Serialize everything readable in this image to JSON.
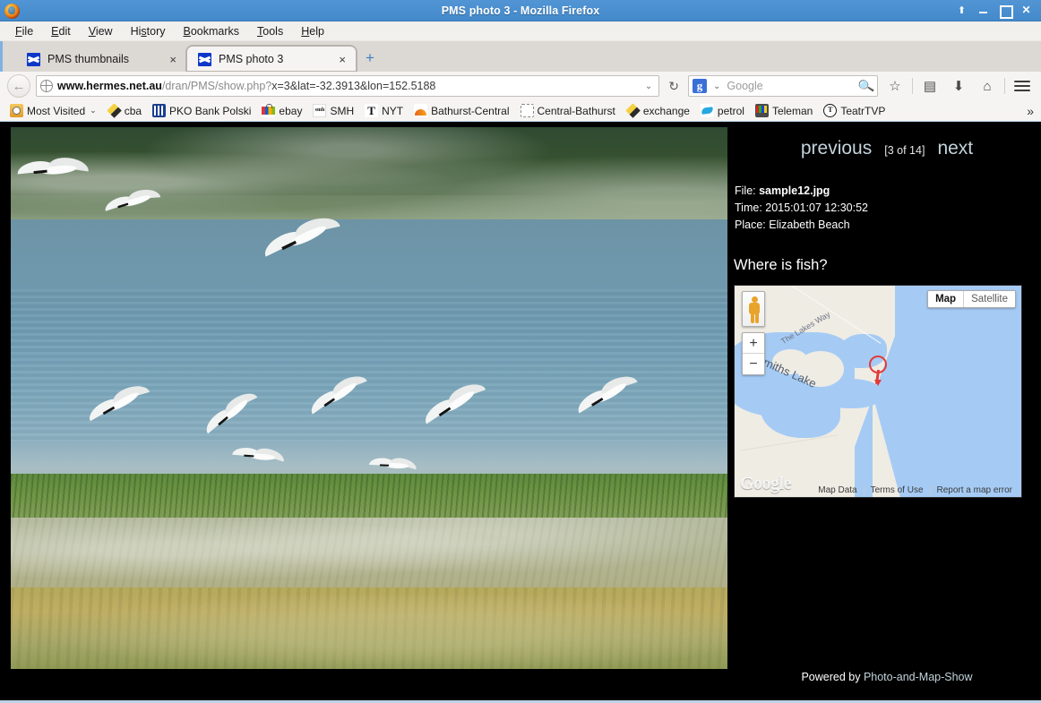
{
  "window": {
    "title": "PMS photo 3 - Mozilla Firefox",
    "controls": {
      "shade": "shade-button",
      "minimize": "minimize-button",
      "maximize": "maximize-button",
      "close": "close-button"
    }
  },
  "menubar": {
    "items": [
      {
        "label": "File",
        "accel": "F"
      },
      {
        "label": "Edit",
        "accel": "E"
      },
      {
        "label": "View",
        "accel": "V"
      },
      {
        "label": "History",
        "accel": "s"
      },
      {
        "label": "Bookmarks",
        "accel": "B"
      },
      {
        "label": "Tools",
        "accel": "T"
      },
      {
        "label": "Help",
        "accel": "H"
      }
    ]
  },
  "tabs": [
    {
      "label": "PMS thumbnails",
      "active": false,
      "close": "×"
    },
    {
      "label": "PMS photo 3",
      "active": true,
      "close": "×"
    }
  ],
  "newtab_label": "+",
  "toolbar": {
    "back_icon": "←",
    "url": {
      "scheme_host": "www.hermes.net.au",
      "path": "/dran/PMS/show.php?",
      "query": "x=3&lat=-32.3913&lon=152.5188",
      "full": "www.hermes.net.au/dran/PMS/show.php?x=3&lat=-32.3913&lon=152.5188"
    },
    "url_dropdown": "⌄",
    "reload_icon": "↻",
    "search_engine": "g",
    "search_placeholder": "Google",
    "search_icon": "🔍",
    "bookmark_star": "☆",
    "reader_icon": "▤",
    "download_icon": "⬇",
    "home_icon": "⌂",
    "menu_icon": "hamburger"
  },
  "bookmarks": {
    "items": [
      {
        "label": "Most Visited",
        "icon": "folder-icon",
        "caret": "⌄"
      },
      {
        "label": "cba",
        "icon": "diamond-icon"
      },
      {
        "label": "PKO Bank Polski",
        "icon": "pko-icon"
      },
      {
        "label": "ebay",
        "icon": "ebay-icon"
      },
      {
        "label": "SMH",
        "icon": "smh-icon",
        "glyph": "smh"
      },
      {
        "label": "NYT",
        "icon": "nyt-icon",
        "glyph": "T"
      },
      {
        "label": "Bathurst-Central",
        "icon": "rainbow-icon"
      },
      {
        "label": "Central-Bathurst",
        "icon": "dashed-box-icon"
      },
      {
        "label": "exchange",
        "icon": "diamond-icon"
      },
      {
        "label": "petrol",
        "icon": "petrol-icon"
      },
      {
        "label": "Teleman",
        "icon": "tv-icon"
      },
      {
        "label": "TeatrTVP",
        "icon": "tvp-icon",
        "glyph": "T"
      }
    ],
    "overflow": "»"
  },
  "photo": {
    "alt": "Terns flying over shallow water at a beach",
    "caption_hidden": ""
  },
  "sidebar": {
    "nav": {
      "previous": "previous",
      "counter": "[3 of 14]",
      "next": "next"
    },
    "meta": [
      {
        "label": "File:",
        "value": "sample12.jpg",
        "bold": true
      },
      {
        "label": "Time:",
        "value": "2015:01:07 12:30:52",
        "bold": false
      },
      {
        "label": "Place:",
        "value": "Elizabeth Beach",
        "bold": false
      }
    ],
    "heading": "Where is fish?",
    "map": {
      "type_toggle": {
        "selected": "Map",
        "other": "Satellite"
      },
      "zoom_in": "+",
      "zoom_out": "−",
      "pegman": "street-view-pegman",
      "labels": [
        {
          "text": "The Lakes Way",
          "kind": "road"
        },
        {
          "text": "Smiths Lake",
          "kind": "water"
        }
      ],
      "marker": "red-location-pin",
      "logo": "Google",
      "attribution": [
        "Map Data",
        "Terms of Use",
        "Report a map error"
      ]
    },
    "footer": {
      "prefix": "Powered by ",
      "link": "Photo-and-Map-Show"
    }
  },
  "colors": {
    "titlebar": "#4a8fd0",
    "page_bg": "#000000",
    "link": "#c3d3dc",
    "accent": "#0d37c8",
    "marker": "#e23b3b",
    "map_water": "#a5cbf5",
    "map_land": "#efece4"
  }
}
